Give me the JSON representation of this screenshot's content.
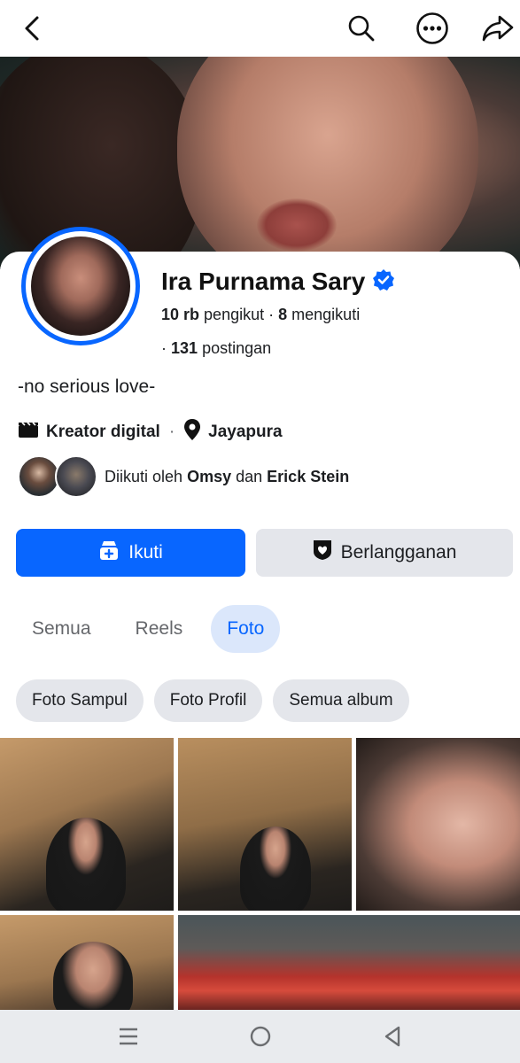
{
  "topbar": {
    "icons": [
      "back-arrow-icon",
      "search-icon",
      "more-icon",
      "share-icon"
    ]
  },
  "profile": {
    "name": "Ira Purnama Sary",
    "verified": true,
    "followers_count": "10 rb",
    "followers_label": "pengikut",
    "following_count": "8",
    "following_label": "mengikuti",
    "posts_count": "131",
    "posts_label": "postingan",
    "bio": "-no serious love-",
    "category": "Kreator digital",
    "location": "Jayapura",
    "followed_by_prefix": "Diikuti oleh",
    "followed_by_1": "Omsy",
    "followed_by_join": "dan",
    "followed_by_2": "Erick Stein"
  },
  "actions": {
    "follow_label": "Ikuti",
    "subscribe_label": "Berlangganan"
  },
  "tabs": [
    {
      "label": "Semua",
      "active": false
    },
    {
      "label": "Reels",
      "active": false
    },
    {
      "label": "Foto",
      "active": true
    }
  ],
  "chips": [
    "Foto Sampul",
    "Foto Profil",
    "Semua album"
  ],
  "colors": {
    "accent": "#0866ff",
    "tab_active_bg": "#dbe7fb",
    "chip_bg": "#e4e6eb"
  }
}
